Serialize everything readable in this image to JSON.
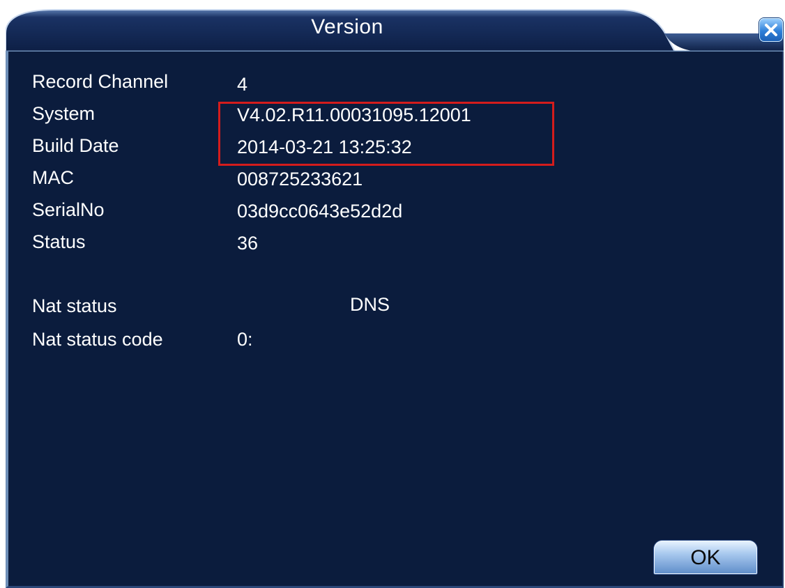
{
  "window": {
    "title": "Version"
  },
  "info": {
    "rows": [
      {
        "label": "Record Channel",
        "value": "4"
      },
      {
        "label": "System",
        "value": "V4.02.R11.00031095.12001"
      },
      {
        "label": "Build Date",
        "value": "2014-03-21 13:25:32"
      },
      {
        "label": "MAC",
        "value": "008725233621"
      },
      {
        "label": "SerialNo",
        "value": "03d9cc0643e52d2d"
      },
      {
        "label": "Status",
        "value": "36"
      },
      {
        "label": "Nat status",
        "value": "DNS"
      },
      {
        "label": "Nat status code",
        "value": "0:"
      }
    ]
  },
  "buttons": {
    "ok_label": "OK"
  },
  "icons": {
    "close": "close-icon"
  },
  "colors": {
    "panel_background": "#0b1c3d",
    "title_bar": "#11244f",
    "highlight_border": "#d41c1c",
    "text": "#ffffff"
  }
}
